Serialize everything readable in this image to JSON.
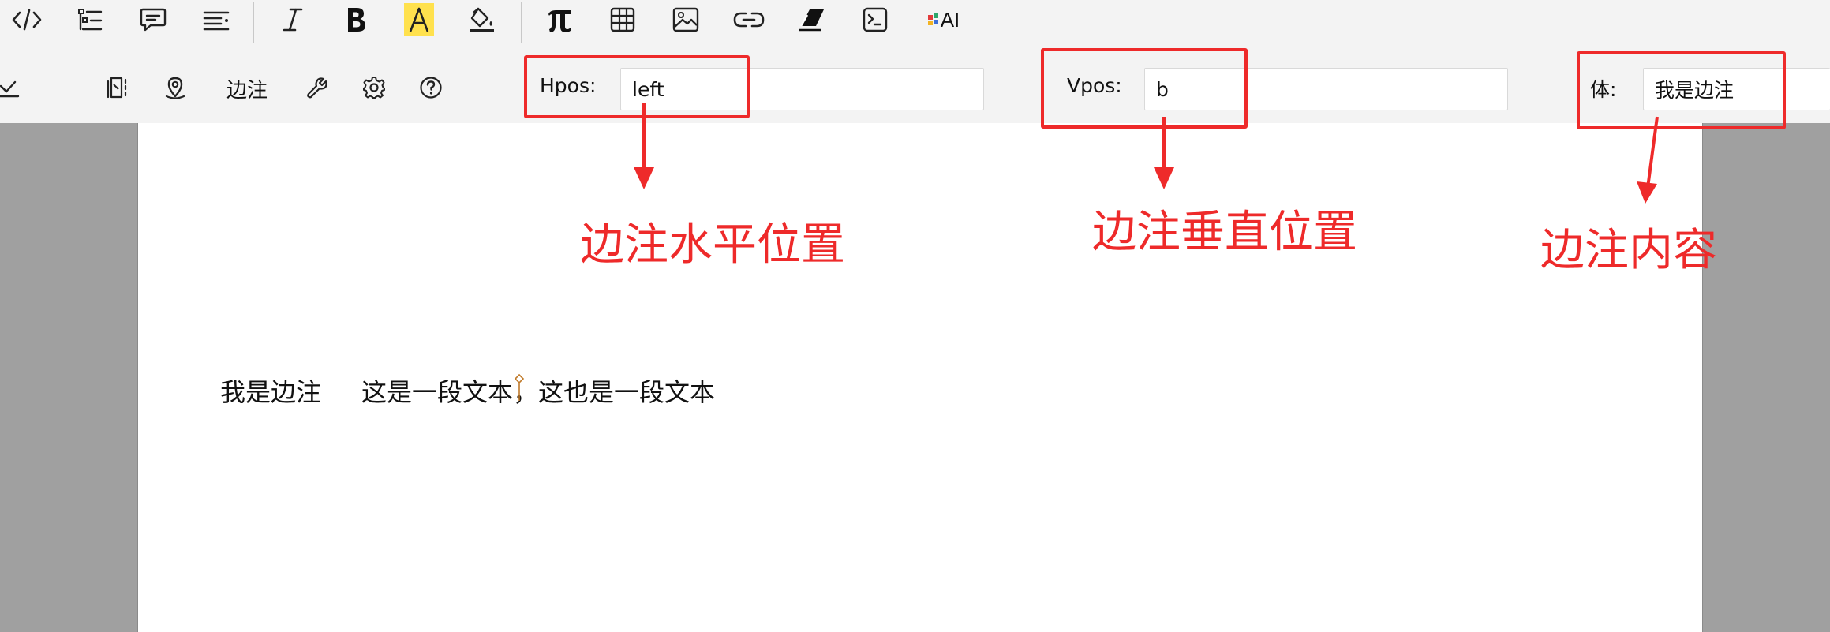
{
  "toolbar_top": {
    "icons": [
      "code-icon",
      "outline-list-icon",
      "comment-icon",
      "align-list-icon",
      "italic-icon",
      "bold-icon",
      "highlight-icon",
      "fill-color-icon",
      "pi-icon",
      "table-icon",
      "image-icon",
      "link-icon",
      "eraser-icon",
      "terminal-icon",
      "ai-icon"
    ],
    "ai_label": "AI"
  },
  "toolbar_sub": {
    "margin_note_label": "边注",
    "hpos_label": "Hpos:",
    "hpos_value": "left",
    "vpos_label": "Vpos:",
    "vpos_value": "b",
    "body_label": "体:",
    "body_value": "我是边注"
  },
  "document": {
    "margin_note_text": "我是边注",
    "body_text": "这是一段文本，这也是一段文本"
  },
  "annotations": {
    "hpos": "边注水平位置",
    "vpos": "边注垂直位置",
    "body": "边注内容"
  },
  "colors": {
    "annotation": "#ee2a2a",
    "highlight": "#ffe14d",
    "page": "#ffffff",
    "gutter": "#a0a0a0"
  }
}
